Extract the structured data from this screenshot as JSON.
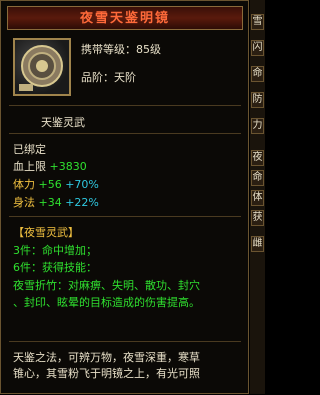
{
  "title": "夜雪天鉴明镜",
  "header": {
    "level_req": "携带等级：85级",
    "grade": "品阶：天阶"
  },
  "item_name": "天鉴灵武",
  "bound": "已绑定",
  "stats": [
    {
      "label": "血上限",
      "value": "+3830",
      "pct": ""
    },
    {
      "label": "体力",
      "value": "+56",
      "pct": "+70%"
    },
    {
      "label": "身法",
      "value": "+34",
      "pct": "+22%"
    }
  ],
  "set": {
    "name": "【夜雪灵武】",
    "bonus3": "3件：命中增加；",
    "bonus6": "6件：获得技能：",
    "skill_line1": "夜雪折竹：对麻痹、失明、散功、封穴",
    "skill_line2": "、封印、眩晕的目标造成的伤害提高。"
  },
  "description": {
    "line1": "天鉴之法，可辨万物，夜雪深重，寒草",
    "line2": "锥心，其雪粉飞于明镜之上，有光可照"
  },
  "side_tabs": [
    "雪",
    "闪",
    "命",
    "防",
    "力",
    "夜",
    "命",
    "体",
    "获",
    "雌"
  ],
  "icons": {
    "item": "mirror-icon"
  },
  "colors": {
    "title": "#ff6a3a",
    "stat_green": "#2fe02f",
    "stat_cyan": "#2fc8e0",
    "set": "#f0c040"
  }
}
